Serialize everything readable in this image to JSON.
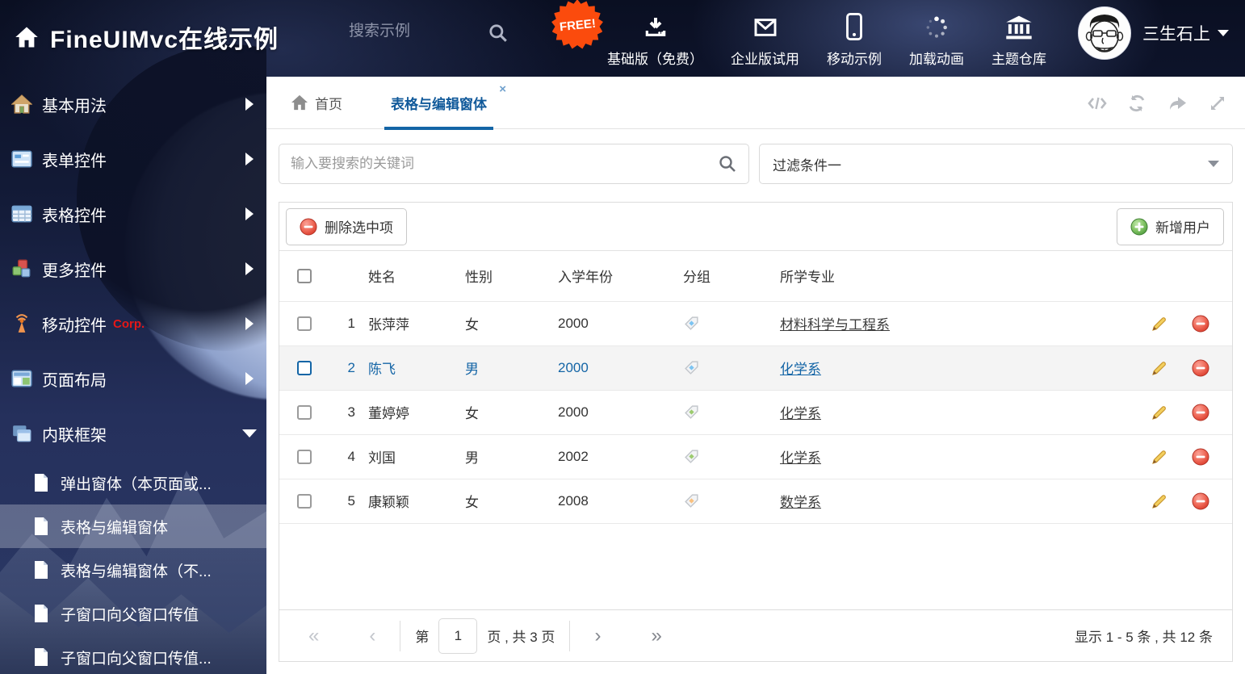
{
  "header": {
    "title": "FineUIMvc在线示例",
    "search_placeholder": "搜索示例",
    "free_badge": "FREE!",
    "nav": [
      {
        "label": "基础版（免费）",
        "icon": "download-icon"
      },
      {
        "label": "企业版试用",
        "icon": "envelope-icon"
      },
      {
        "label": "移动示例",
        "icon": "mobile-icon"
      },
      {
        "label": "加载动画",
        "icon": "spinner-icon"
      },
      {
        "label": "主题仓库",
        "icon": "bank-icon"
      }
    ],
    "username": "三生石上"
  },
  "sidebar": {
    "items": [
      {
        "label": "基本用法",
        "icon": "home-icon"
      },
      {
        "label": "表单控件",
        "icon": "form-icon"
      },
      {
        "label": "表格控件",
        "icon": "table-icon"
      },
      {
        "label": "更多控件",
        "icon": "cubes-icon"
      },
      {
        "label": "移动控件",
        "badge": "Corp.",
        "icon": "antenna-icon"
      },
      {
        "label": "页面布局",
        "icon": "layout-icon"
      },
      {
        "label": "内联框架",
        "icon": "frames-icon",
        "state": "expanded"
      }
    ],
    "subitems": [
      {
        "label": "弹出窗体（本页面或..."
      },
      {
        "label": "表格与编辑窗体",
        "active": true
      },
      {
        "label": "表格与编辑窗体（不..."
      },
      {
        "label": "子窗口向父窗口传值"
      },
      {
        "label": "子窗口向父窗口传值..."
      }
    ]
  },
  "tabs": {
    "home": "首页",
    "active": "表格与编辑窗体",
    "close": "×"
  },
  "search_bar": {
    "keyword_placeholder": "输入要搜索的关键词",
    "filter_value": "过滤条件一"
  },
  "grid": {
    "delete_button": "删除选中项",
    "add_button": "新增用户",
    "columns": {
      "name": "姓名",
      "gender": "性别",
      "year": "入学年份",
      "group": "分组",
      "major": "所学专业"
    },
    "rows": [
      {
        "num": "1",
        "name": "张萍萍",
        "gender": "女",
        "year": "2000",
        "tag_color": "#7cc4f2",
        "major": "材料科学与工程系",
        "selected": false
      },
      {
        "num": "2",
        "name": "陈飞",
        "gender": "男",
        "year": "2000",
        "tag_color": "#7cc4f2",
        "major": "化学系",
        "selected": true
      },
      {
        "num": "3",
        "name": "董婷婷",
        "gender": "女",
        "year": "2000",
        "tag_color": "#9ccb6f",
        "major": "化学系",
        "selected": false
      },
      {
        "num": "4",
        "name": "刘国",
        "gender": "男",
        "year": "2002",
        "tag_color": "#9ccb6f",
        "major": "化学系",
        "selected": false
      },
      {
        "num": "5",
        "name": "康颖颖",
        "gender": "女",
        "year": "2008",
        "tag_color": "#f9c180",
        "major": "数学系",
        "selected": false
      }
    ],
    "pagination": {
      "first": "«",
      "prev": "‹",
      "next": "›",
      "last": "»",
      "prefix": "第",
      "page": "1",
      "suffix": "页 , 共 3 页",
      "summary": "显示 1 - 5 条 , 共 12 条"
    }
  },
  "colors": {
    "accent_blue": "#1465a6",
    "tab_text": "#10599a",
    "corp_red": "#e51717",
    "badge_orange": "#fb4b0d",
    "delete_red": "#e4493b",
    "add_green": "#62b152",
    "pencil_gold": "#f3cf5e"
  }
}
